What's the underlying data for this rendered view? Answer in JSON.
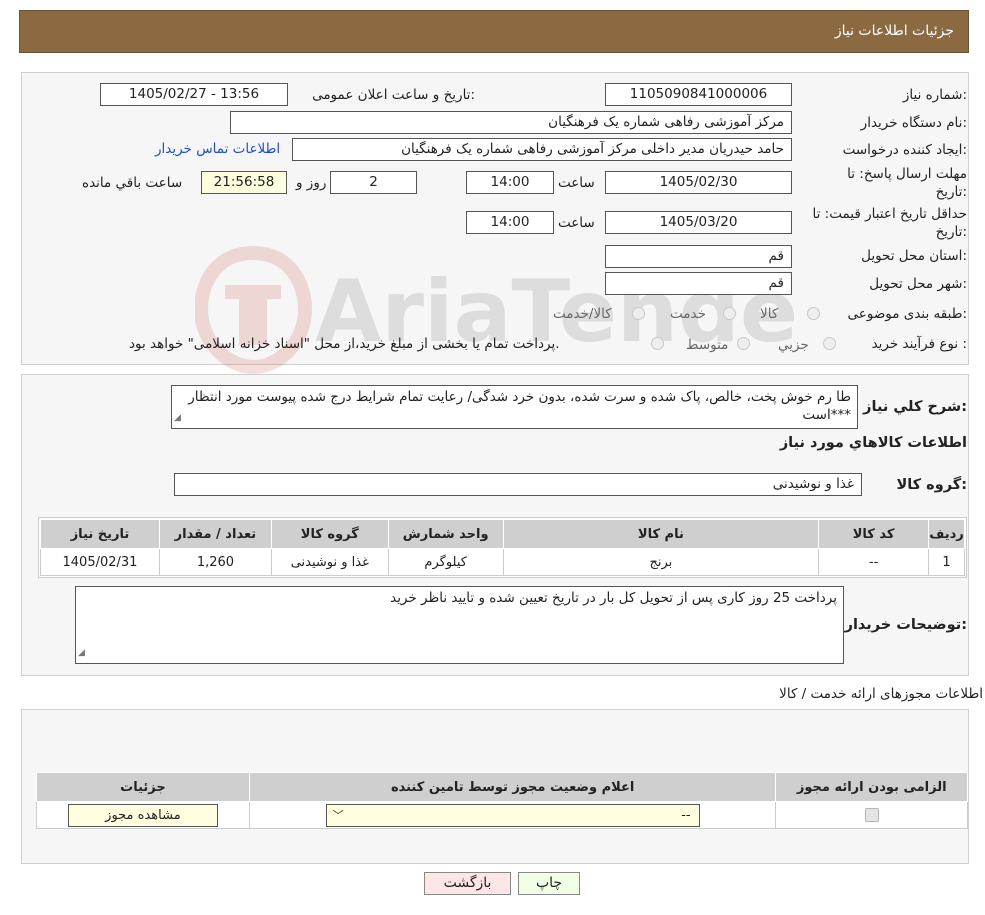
{
  "header": {
    "title": "جزئیات اطلاعات نیاز"
  },
  "watermark": {
    "text": "AriaTender.neT"
  },
  "form": {
    "need_number_label": "شماره نیاز:",
    "need_number": "1105090841000006",
    "announce_label": "تاریخ و ساعت اعلان عمومی:",
    "announce_value": "1405/02/27 - 13:56",
    "buyer_label": "نام دستگاه خریدار:",
    "buyer": "مرکز آموزشی رفاهی شماره یک فرهنگیان",
    "creator_label": "ایجاد کننده درخواست:",
    "creator": "حامد حیدریان مدیر داخلی مرکز آموزشی رفاهی شماره یک فرهنگیان",
    "contact_link": "اطلاعات تماس خریدار",
    "deadline_label_1": "مهلت ارسال پاسخ: تا",
    "deadline_label_2": "تاریخ:",
    "deadline_date": "1405/02/30",
    "time_label": "ساعت",
    "deadline_time": "14:00",
    "days_count": "2",
    "days_label": "روز و",
    "remaining_time": "21:56:58",
    "remaining_label": "ساعت باقي مانده",
    "validity_label_1": "حداقل تاریخ اعتبار قیمت: تا",
    "validity_label_2": "تاریخ:",
    "validity_date": "1405/03/20",
    "validity_time": "14:00",
    "province_label": "استان محل تحویل:",
    "province": "قم",
    "city_label": "شهر محل تحویل:",
    "city": "قم",
    "category_label": "طبقه بندی موضوعی:",
    "category_options": [
      "کالا",
      "خدمت",
      "کالا/خدمت"
    ],
    "process_label": "نوع فرآیند خرید :",
    "process_options": [
      "جزیي",
      "متوسط"
    ],
    "process_note": "پرداخت تمام یا بخشی از مبلغ خرید،از محل \"اسناد خزانه اسلامی\" خواهد بود."
  },
  "details": {
    "description_label": "شرح کلي نیاز:",
    "description": "طا رم خوش پخت، خالص، پاک شده و سرت شده، بدون خرد شدگی/ رعایت تمام شرایط درج شده پیوست مورد انتظار است***",
    "goods_title": "اطلاعات کالاهاي مورد نیاز",
    "group_label": "گروه کالا:",
    "group_value": "غذا و نوشیدنی",
    "table": {
      "headers": [
        "ردیف",
        "کد کالا",
        "نام کالا",
        "واحد شمارش",
        "گروه کالا",
        "تعداد / مقدار",
        "تاریخ نیاز"
      ],
      "rows": [
        [
          "1",
          "--",
          "برنج",
          "کیلوگرم",
          "غذا و نوشیدنی",
          "1,260",
          "1405/02/31"
        ]
      ]
    },
    "buyer_notes_label": "توضیحات خریدار:",
    "buyer_notes": "پرداخت 25 روز کاری پس از تحویل کل بار در تاریخ تعیین شده و تایید ناظر خرید"
  },
  "licenses": {
    "title": "اطلاعات مجوزهای ارائه خدمت / کالا",
    "headers": [
      "الزامی بودن ارائه مجوز",
      "اعلام وضعیت مجوز توسط تامین کننده",
      "جزئیات"
    ],
    "select_value": "--",
    "view_button": "مشاهده مجوز"
  },
  "buttons": {
    "print": "چاپ",
    "back": "بازگشت"
  }
}
